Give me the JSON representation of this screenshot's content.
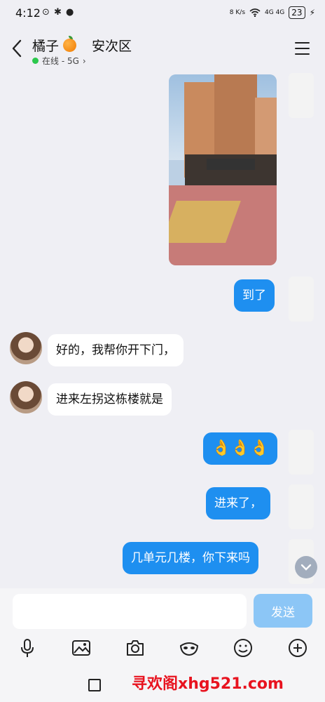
{
  "status": {
    "time": "4:12",
    "left_icons": "⊙ ✱ ●",
    "net_speed": "8 K/s",
    "signal": "4G 4G",
    "battery": "23"
  },
  "header": {
    "title_name": "橘子",
    "title_location": "安次区",
    "presence": "在线 - 5G",
    "presence_chevron": "›"
  },
  "messages": [
    {
      "direction": "out",
      "type": "image"
    },
    {
      "direction": "out",
      "type": "text",
      "text": "到了"
    },
    {
      "direction": "in",
      "type": "text",
      "text": "好的，我帮你开下门，"
    },
    {
      "direction": "in",
      "type": "text",
      "text": "进来左拐这栋楼就是"
    },
    {
      "direction": "out",
      "type": "sticker",
      "text": "👌👌👌"
    },
    {
      "direction": "out",
      "type": "text",
      "text": "进来了，"
    },
    {
      "direction": "out",
      "type": "text",
      "text": "几单元几楼，你下来吗"
    }
  ],
  "composer": {
    "placeholder": "",
    "send_label": "发送"
  },
  "toolbar": [
    "mic-icon",
    "image-icon",
    "camera-icon",
    "mask-icon",
    "emoji-icon",
    "plus-icon"
  ],
  "watermark": "寻欢阁xhg521.com"
}
